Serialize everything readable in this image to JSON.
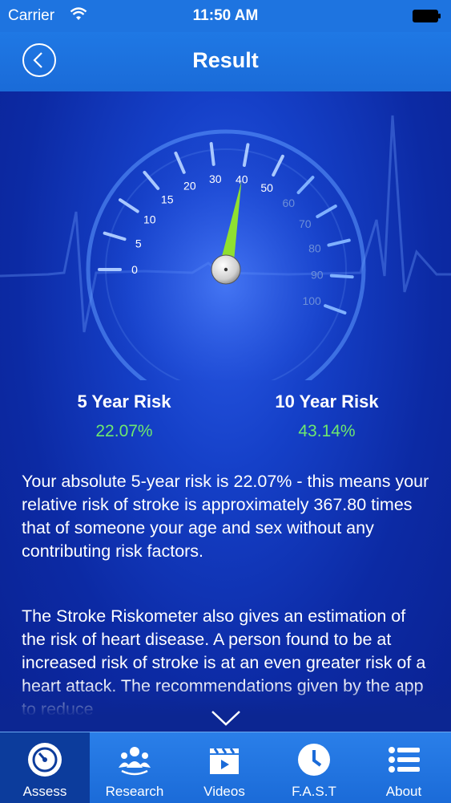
{
  "status_bar": {
    "carrier": "Carrier",
    "time": "11:50 AM"
  },
  "nav": {
    "title": "Result"
  },
  "gauge": {
    "value": 40,
    "ticks": [
      "0",
      "5",
      "10",
      "15",
      "20",
      "30",
      "40",
      "50",
      "60",
      "70",
      "80",
      "90",
      "100"
    ]
  },
  "risk": {
    "five_year_label": "5 Year Risk",
    "five_year_value": "22.07%",
    "ten_year_label": "10 Year Risk",
    "ten_year_value": "43.14%"
  },
  "body_text": {
    "paragraph1": "Your absolute 5-year risk is 22.07% - this means your relative risk of stroke is approximately 367.80 times that of someone your age and sex without any contributing risk factors.",
    "paragraph2": "The Stroke Riskometer also gives an estimation of the risk of heart disease. A person found to be at increased risk of stroke is at an even greater risk of a heart attack. The recommendations given by the app to reduce"
  },
  "tabs": [
    {
      "label": "Assess",
      "icon": "gauge-icon",
      "active": true
    },
    {
      "label": "Research",
      "icon": "people-icon",
      "active": false
    },
    {
      "label": "Videos",
      "icon": "clapperboard-icon",
      "active": false
    },
    {
      "label": "F.A.S.T",
      "icon": "clock-icon",
      "active": false
    },
    {
      "label": "About",
      "icon": "list-icon",
      "active": false
    }
  ],
  "colors": {
    "accent": "#1e74e0",
    "risk_value": "#6ee86e",
    "needle": "#8fe030"
  }
}
